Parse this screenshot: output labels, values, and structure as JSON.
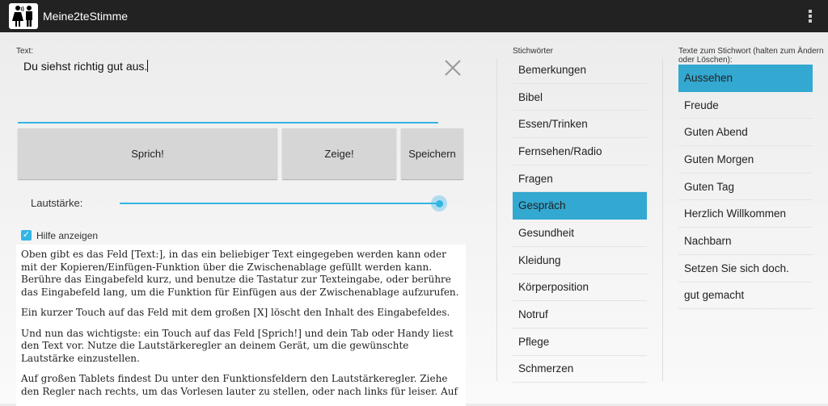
{
  "app": {
    "title": "Meine2teStimme",
    "menu_icon": "overflow-menu-icon"
  },
  "editor": {
    "label": "Text:",
    "value": "Du siehst richtig gut aus.",
    "clear_icon": "close-x-icon"
  },
  "buttons": {
    "speak": "Sprich!",
    "show": "Zeige!",
    "save": "Speichern"
  },
  "volume": {
    "label": "Lautstärke:",
    "value_percent": 100
  },
  "help": {
    "checkbox_label": "Hilfe anzeigen",
    "checked": true,
    "paragraphs": [
      "Oben gibt es das Feld [Text:], in das ein beliebiger Text eingegeben werden kann oder mit der Kopieren/Einfügen-Funktion über die Zwischenablage gefüllt werden kann. Berühre das Eingabefeld kurz, und benutze die Tastatur zur Texteingabe, oder berühre das Eingabefeld lang, um die Funktion für Einfügen aus der Zwischenablage aufzurufen.",
      "Ein kurzer Touch auf das Feld mit dem großen [X] löscht den Inhalt des Eingabefeldes.",
      "Und nun das wichtigste: ein Touch auf das Feld [Sprich!] und dein Tab oder Handy liest den Text vor. Nutze die Lautstärkeregler an deinem Gerät, um die gewünschte Lautstärke einzustellen.",
      "Auf großen Tablets findest Du unter den Funktionsfeldern den Lautstärkeregler. Ziehe den Regler nach rechts, um das Vorlesen lauter zu stellen, oder nach links für leiser. Auf"
    ]
  },
  "keywords": {
    "header": "Stichwörter",
    "selected": "Gespräch",
    "items": [
      "Bemerkungen",
      "Bibel",
      "Essen/Trinken",
      "Fernsehen/Radio",
      "Fragen",
      "Gespräch",
      "Gesundheit",
      "Kleidung",
      "Körperposition",
      "Notruf",
      "Pflege",
      "Schmerzen"
    ]
  },
  "texts": {
    "header": "Texte zum Stichwort (halten zum Ändern oder Löschen):",
    "selected": "Aussehen",
    "items": [
      "Aussehen",
      "Freude",
      "Guten Abend",
      "Guten Morgen",
      "Guten Tag",
      "Herzlich Willkommen",
      "Nachbarn",
      "Setzen Sie sich doch.",
      "gut gemacht"
    ]
  },
  "colors": {
    "accent": "#33b5e5",
    "selected": "#33a8d0",
    "topbar": "#222222"
  }
}
